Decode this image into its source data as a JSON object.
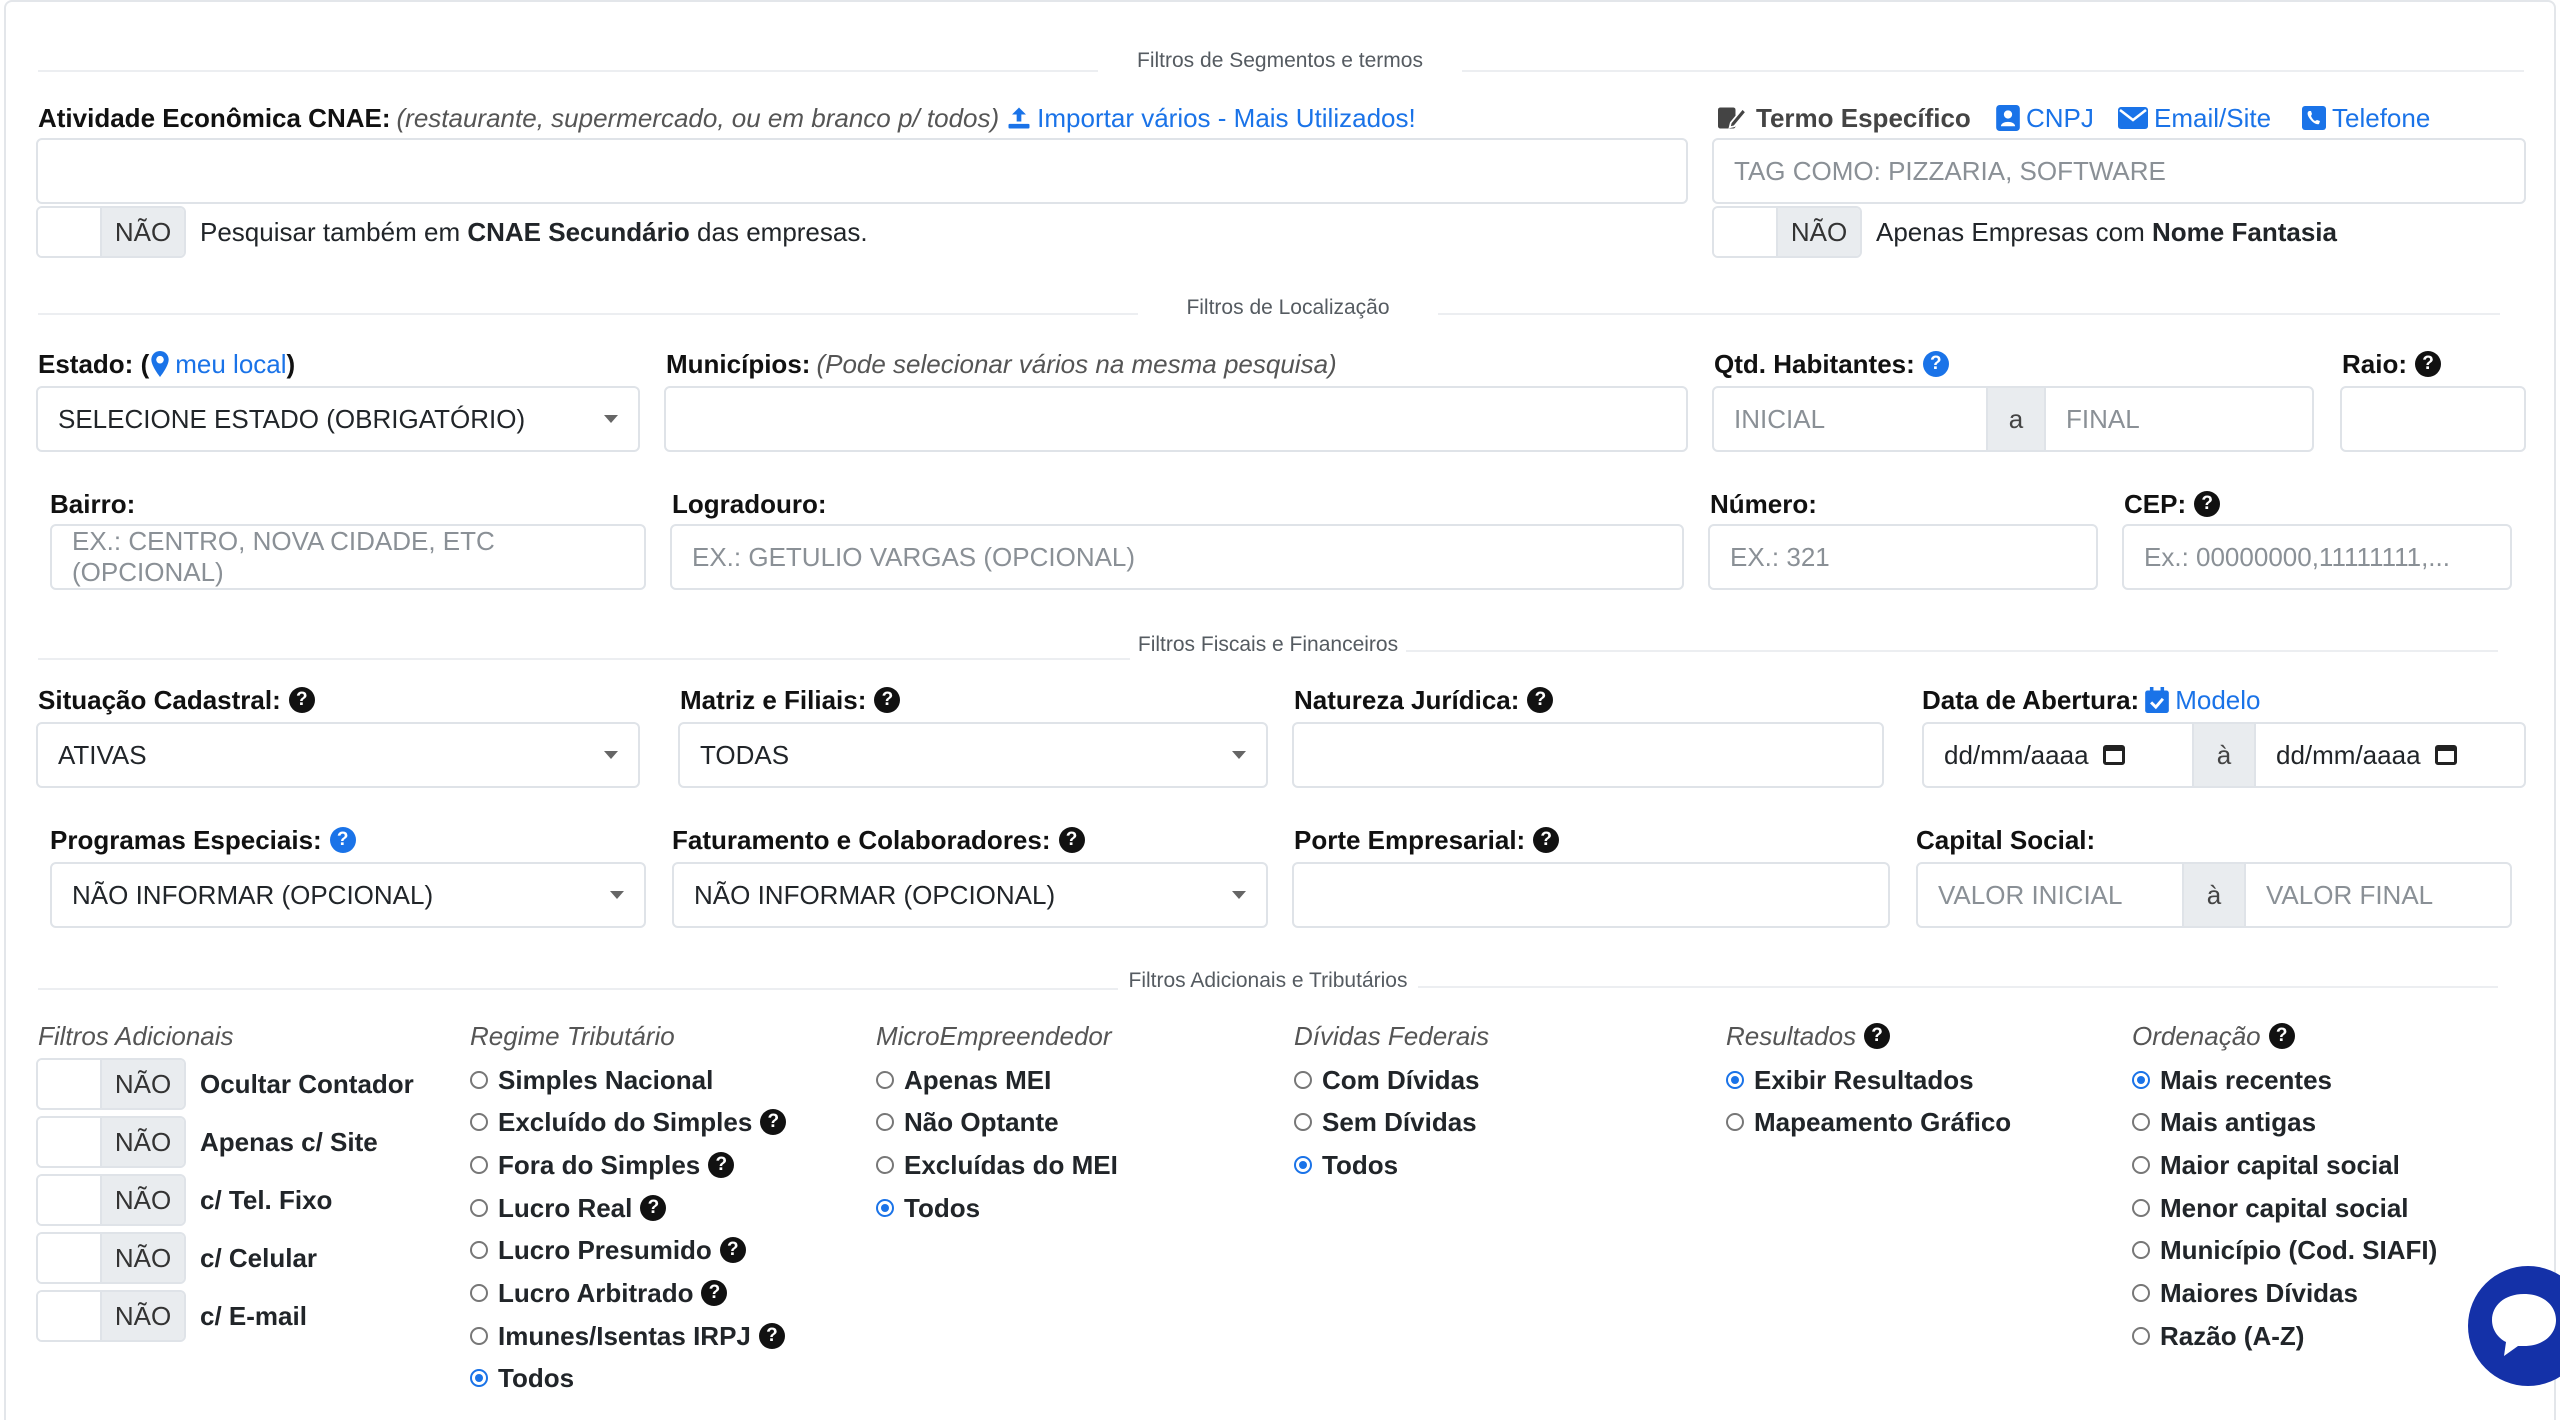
{
  "sections": {
    "segments": "Filtros de Segmentos e termos",
    "location": "Filtros de Localização",
    "fiscal": "Filtros Fiscais e Financeiros",
    "additional": "Filtros Adicionais e Tributários"
  },
  "cnae": {
    "label": "Atividade Econômica CNAE:",
    "hint": "(restaurante, supermercado, ou em branco p/ todos)",
    "import_link": "Importar vários - Mais Utilizados!",
    "value": "",
    "toggle_state": "NÃO",
    "toggle_text_pre": "Pesquisar também em ",
    "toggle_text_bold": "CNAE Secundário",
    "toggle_text_post": " das empresas."
  },
  "term": {
    "label": "Termo Específico",
    "tabs": [
      "CNPJ",
      "Email/Site",
      "Telefone"
    ],
    "placeholder": "TAG COMO: PIZZARIA, SOFTWARE",
    "toggle_state": "NÃO",
    "toggle_text_pre": "Apenas Empresas com ",
    "toggle_text_bold": "Nome Fantasia"
  },
  "estado": {
    "label": "Estado: (",
    "link": "meu local",
    "label_close": ")",
    "value": "SELECIONE ESTADO (OBRIGATÓRIO)"
  },
  "municipios": {
    "label": "Municípios:",
    "hint": "(Pode selecionar vários na mesma pesquisa)"
  },
  "habitantes": {
    "label": "Qtd. Habitantes:",
    "ph_initial": "INICIAL",
    "sep": "a",
    "ph_final": "FINAL"
  },
  "raio": {
    "label": "Raio:"
  },
  "bairro": {
    "label": "Bairro:",
    "placeholder": "EX.: CENTRO, NOVA CIDADE, ETC (OPCIONAL)"
  },
  "logradouro": {
    "label": "Logradouro:",
    "placeholder": "EX.: GETULIO VARGAS (OPCIONAL)"
  },
  "numero": {
    "label": "Número:",
    "placeholder": "EX.: 321"
  },
  "cep": {
    "label": "CEP:",
    "placeholder": "Ex.: 00000000,11111111,..."
  },
  "situacao": {
    "label": "Situação Cadastral:",
    "value": "ATIVAS"
  },
  "matriz": {
    "label": "Matriz e Filiais:",
    "value": "TODAS"
  },
  "natureza": {
    "label": "Natureza Jurídica:"
  },
  "abertura": {
    "label": "Data de Abertura:",
    "link": "Modelo",
    "date_ph": "dd/mm/aaaa",
    "sep": "à"
  },
  "programas": {
    "label": "Programas Especiais:",
    "value": "NÃO INFORMAR (OPCIONAL)"
  },
  "faturamento": {
    "label": "Faturamento e Colaboradores:",
    "value": "NÃO INFORMAR (OPCIONAL)"
  },
  "porte": {
    "label": "Porte Empresarial:"
  },
  "capital": {
    "label": "Capital Social:",
    "ph_initial": "VALOR INICIAL",
    "sep": "à",
    "ph_final": "VALOR FINAL"
  },
  "adicionais": {
    "title": "Filtros Adicionais",
    "toggles": [
      {
        "state": "NÃO",
        "label": "Ocultar Contador"
      },
      {
        "state": "NÃO",
        "label": "Apenas c/ Site"
      },
      {
        "state": "NÃO",
        "label": "c/ Tel. Fixo"
      },
      {
        "state": "NÃO",
        "label": "c/ Celular"
      },
      {
        "state": "NÃO",
        "label": "c/ E-mail"
      }
    ]
  },
  "regime": {
    "title": "Regime Tributário",
    "options": [
      "Simples Nacional",
      "Excluído do Simples",
      "Fora do Simples",
      "Lucro Real",
      "Lucro Presumido",
      "Lucro Arbitrado",
      "Imunes/Isentas IRPJ",
      "Todos"
    ]
  },
  "mei": {
    "title": "MicroEmpreendedor",
    "options": [
      "Apenas MEI",
      "Não Optante",
      "Excluídas do MEI",
      "Todos"
    ]
  },
  "dividas": {
    "title": "Dívidas Federais",
    "options": [
      "Com Dívidas",
      "Sem Dívidas",
      "Todos"
    ]
  },
  "resultados": {
    "title": "Resultados",
    "options": [
      "Exibir Resultados",
      "Mapeamento Gráfico"
    ]
  },
  "ordenacao": {
    "title": "Ordenação",
    "options": [
      "Mais recentes",
      "Mais antigas",
      "Maior capital social",
      "Menor capital social",
      "Município (Cod. SIAFI)",
      "Maiores Dívidas",
      "Razão (A-Z)"
    ]
  },
  "colors": {
    "accent": "#1a73e8",
    "chat": "#1431a8"
  }
}
